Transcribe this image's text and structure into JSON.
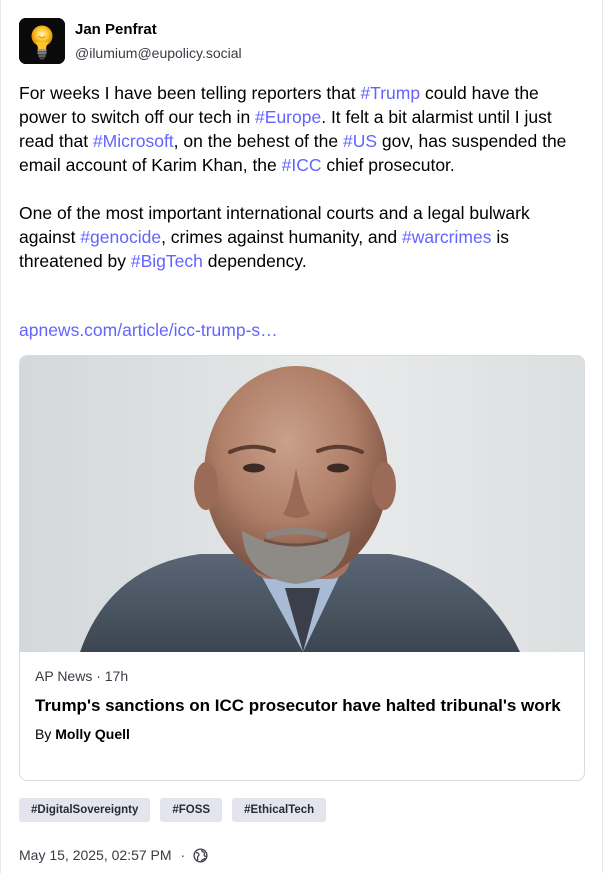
{
  "author": {
    "display_name": "Jan Penfrat",
    "handle": "@ilumium@eupolicy.social",
    "avatar_icon": "lightbulb-icon"
  },
  "post": {
    "paragraph1": [
      {
        "text": "For weeks I have been telling reporters that "
      },
      {
        "text": "#Trump",
        "hashtag": true
      },
      {
        "text": " could have the power to switch off our tech in "
      },
      {
        "text": "#Europe",
        "hashtag": true
      },
      {
        "text": ". It felt a bit alarmist until I just read that "
      },
      {
        "text": "#Microsoft",
        "hashtag": true
      },
      {
        "text": ", on the behest of the "
      },
      {
        "text": "#US",
        "hashtag": true
      },
      {
        "text": " gov, has suspended the email account of Karim Khan, the "
      },
      {
        "text": "#ICC",
        "hashtag": true
      },
      {
        "text": " chief prosecutor."
      }
    ],
    "paragraph2": [
      {
        "text": "One of the most important international courts and a legal bulwark against  "
      },
      {
        "text": "#genocide",
        "hashtag": true
      },
      {
        "text": ", crimes against humanity, and "
      },
      {
        "text": "#warcrimes",
        "hashtag": true
      },
      {
        "text": " is threatened by "
      },
      {
        "text": "#BigTech",
        "hashtag": true
      },
      {
        "text": " dependency."
      }
    ],
    "link_text": "apnews.com/article/icc-trump-s…"
  },
  "card": {
    "source": "AP News · 17h",
    "title": "Trump's sanctions on ICC prosecutor have halted tribunal's work",
    "author_prefix": "By ",
    "author_name": "Molly Quell"
  },
  "tags": [
    "#DigitalSovereignty",
    "#FOSS",
    "#EthicalTech"
  ],
  "footer": {
    "timestamp": "May 15, 2025, 02:57 PM",
    "separator": "·",
    "visibility_icon": "globe-icon"
  },
  "colors": {
    "accent": "#6364ff",
    "tag_background": "#e4e4ef",
    "secondary_text": "#3b3b45"
  }
}
